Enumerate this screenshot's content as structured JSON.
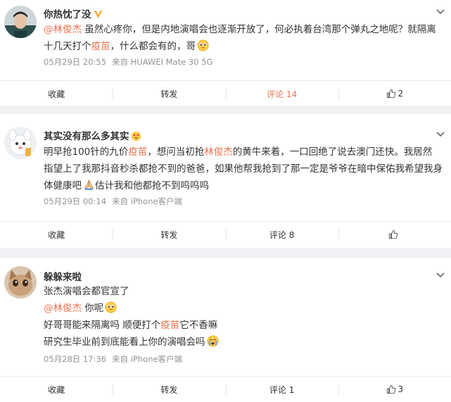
{
  "posts": [
    {
      "username": "你热忱了没",
      "content_lines": [
        {
          "segments": [
            {
              "t": "@林俊杰",
              "c": "at"
            },
            {
              "t": " 虽然心疼你，但是内地演唱会也逐渐开放了，何必执着台湾那个弹丸之地呢？就隔离",
              "c": ""
            }
          ]
        },
        {
          "segments": [
            {
              "t": "十几天打个",
              "c": ""
            },
            {
              "t": "疫苗",
              "c": "kw"
            },
            {
              "t": "，什么都会有的，哥",
              "c": ""
            }
          ],
          "emoji": "pleading-face-icon"
        }
      ],
      "date": "05月29日 20:55",
      "source": "来自 HUAWEI Mate 30 5G",
      "actions": {
        "favorite": "收藏",
        "repost": "转发",
        "comment": "评论 14",
        "like": "2"
      }
    },
    {
      "username": "其实没有那么多其实",
      "content_lines": [
        {
          "segments": [
            {
              "t": "明早抢100针的九价",
              "c": ""
            },
            {
              "t": "疫苗",
              "c": "kw"
            },
            {
              "t": "，想问当初抢",
              "c": ""
            },
            {
              "t": "林俊杰",
              "c": "kw"
            },
            {
              "t": "的黄牛来着，一口回绝了说去澳门还快。我居然",
              "c": ""
            }
          ]
        },
        {
          "segments": [
            {
              "t": "指望上了我那抖音秒杀都抢不到的爸爸，如果他帮我抢到了那一定是爷爷在暗中保佑我希望我身",
              "c": ""
            }
          ]
        },
        {
          "segments": [
            {
              "t": "体健康吧",
              "c": ""
            }
          ],
          "emoji_inline": "praying-hands-icon",
          "tail": "估计我和他都抢不到呜呜呜"
        }
      ],
      "date": "05月29日 00:14",
      "source": "来自 iPhone客户端",
      "actions": {
        "favorite": "收藏",
        "repost": "转发",
        "comment": "评论 8",
        "like": ""
      }
    },
    {
      "username": "躲躲来啦",
      "content_lines": [
        {
          "segments": [
            {
              "t": "张杰演唱会都官宣了",
              "c": ""
            }
          ]
        },
        {
          "segments": [
            {
              "t": "@林俊杰",
              "c": "at"
            },
            {
              "t": " 你呢",
              "c": ""
            }
          ],
          "emoji": "pleading-face-icon"
        },
        {
          "segments": [
            {
              "t": "好哥哥能来隔离吗 顺便打个",
              "c": ""
            },
            {
              "t": "疫苗",
              "c": "kw"
            },
            {
              "t": "它不香嘛",
              "c": ""
            }
          ]
        },
        {
          "segments": [
            {
              "t": "研究生毕业前到底能看上你的演唱会吗",
              "c": ""
            }
          ],
          "emoji": "crying-face-icon"
        }
      ],
      "date": "05月28日 17:36",
      "source": "来自 iPhone客户端",
      "actions": {
        "favorite": "收藏",
        "repost": "转发",
        "comment": "评论 1",
        "like": "3"
      }
    }
  ],
  "colors": {
    "accent": "#eb7350",
    "meta": "#939393",
    "text": "#333333",
    "separator": "#f2f2f5",
    "verified": "#f5a623"
  }
}
